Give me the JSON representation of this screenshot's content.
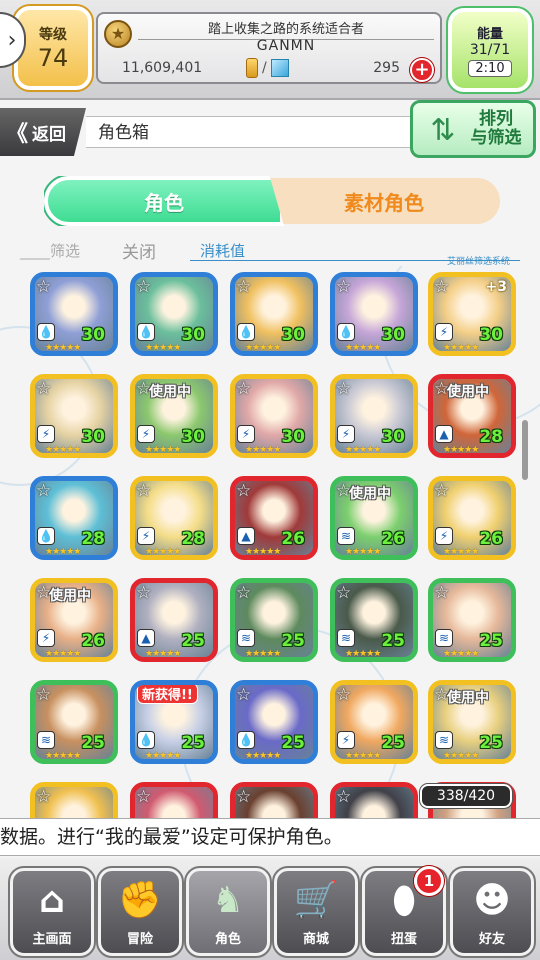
{
  "top_bar": {
    "level_label": "等级",
    "level_value": "74",
    "title": "踏上收集之路的系统适合者",
    "username": "GANMN",
    "gold": "11,609,401",
    "currency_separator": "/",
    "gems": "295",
    "plus_label": "+",
    "energy_label": "能量",
    "energy_value": "31/71",
    "energy_timer": "2:10"
  },
  "sub_header": {
    "back_label": "返回",
    "back_arrows": "《",
    "title": "角色箱",
    "sort_label": "排列\n与筛选"
  },
  "tabs": {
    "character": "角色",
    "material": "素材角色"
  },
  "filter": {
    "filter_label": "筛选",
    "close_label": "关闭",
    "consume_label": "消耗值",
    "system_label": "艾丽丝筛选系统"
  },
  "cards": [
    {
      "level": "30",
      "frame": "#2f7fd8",
      "art": "#8f9fd6",
      "attr": "water",
      "badge": ""
    },
    {
      "level": "30",
      "frame": "#2f7fd8",
      "art": "#6bbf9c",
      "attr": "water",
      "badge": ""
    },
    {
      "level": "30",
      "frame": "#2f7fd8",
      "art": "#f0c060",
      "attr": "water",
      "badge": ""
    },
    {
      "level": "30",
      "frame": "#2f7fd8",
      "art": "#c6a6d8",
      "attr": "water",
      "badge": ""
    },
    {
      "level": "30",
      "frame": "#f2c020",
      "art": "#f4cf88",
      "attr": "thunder",
      "badge": "+3"
    },
    {
      "level": "30",
      "frame": "#f2c020",
      "art": "#e6d3a4",
      "attr": "thunder",
      "badge": ""
    },
    {
      "level": "30",
      "frame": "#f2c020",
      "art": "#8cc86e",
      "attr": "thunder",
      "badge": "使用中"
    },
    {
      "level": "30",
      "frame": "#f2c020",
      "art": "#e0a8a8",
      "attr": "thunder",
      "badge": ""
    },
    {
      "level": "30",
      "frame": "#f2c020",
      "art": "#c9c9d4",
      "attr": "thunder",
      "badge": ""
    },
    {
      "level": "28",
      "frame": "#e2262d",
      "art": "#d0663a",
      "attr": "fire",
      "badge": "使用中"
    },
    {
      "level": "28",
      "frame": "#2f7fd8",
      "art": "#5ebfd6",
      "attr": "water",
      "badge": ""
    },
    {
      "level": "28",
      "frame": "#f2c020",
      "art": "#f4dd88",
      "attr": "thunder",
      "badge": ""
    },
    {
      "level": "26",
      "frame": "#e2262d",
      "art": "#a03a3a",
      "attr": "fire",
      "badge": ""
    },
    {
      "level": "26",
      "frame": "#3fbf5a",
      "art": "#7ccf6e",
      "attr": "wind",
      "badge": "使用中"
    },
    {
      "level": "26",
      "frame": "#f2c020",
      "art": "#f0d070",
      "attr": "thunder",
      "badge": ""
    },
    {
      "level": "26",
      "frame": "#f2c020",
      "art": "#e8b088",
      "attr": "thunder",
      "badge": "使用中"
    },
    {
      "level": "25",
      "frame": "#e2262d",
      "art": "#b0b0c0",
      "attr": "fire",
      "badge": ""
    },
    {
      "level": "25",
      "frame": "#3fbf5a",
      "art": "#5e8a5e",
      "attr": "wind",
      "badge": ""
    },
    {
      "level": "25",
      "frame": "#3fbf5a",
      "art": "#4a5a4a",
      "attr": "wind",
      "badge": ""
    },
    {
      "level": "25",
      "frame": "#3fbf5a",
      "art": "#e6b89a",
      "attr": "wind",
      "badge": ""
    },
    {
      "level": "25",
      "frame": "#3fbf5a",
      "art": "#c89060",
      "attr": "wind",
      "badge": ""
    },
    {
      "level": "25",
      "frame": "#2f7fd8",
      "art": "#c8d0e6",
      "attr": "water",
      "badge": "新获得!!"
    },
    {
      "level": "25",
      "frame": "#2f7fd8",
      "art": "#6a6ac8",
      "attr": "water",
      "badge": ""
    },
    {
      "level": "25",
      "frame": "#f2c020",
      "art": "#f0a860",
      "attr": "thunder",
      "badge": ""
    },
    {
      "level": "25",
      "frame": "#f2c020",
      "art": "#e8d080",
      "attr": "wind",
      "badge": "使用中"
    },
    {
      "level": "",
      "frame": "#f2c020",
      "art": "#f0c050",
      "attr": "",
      "badge": ""
    },
    {
      "level": "",
      "frame": "#e2262d",
      "art": "#d05a70",
      "attr": "",
      "badge": ""
    },
    {
      "level": "",
      "frame": "#e2262d",
      "art": "#6a4030",
      "attr": "",
      "badge": ""
    },
    {
      "level": "",
      "frame": "#e2262d",
      "art": "#404048",
      "attr": "",
      "badge": ""
    },
    {
      "level": "",
      "frame": "#e2262d",
      "art": "#d0a080",
      "attr": "",
      "badge": ""
    }
  ],
  "card_stars": "★★★★★",
  "card_count": "338/420",
  "tip": "数据。进行“我的最爱”设定可保护角色。",
  "nav": [
    {
      "label": "主画面",
      "icon": "home-icon",
      "glyph": "⌂"
    },
    {
      "label": "冒险",
      "icon": "handshake-icon",
      "glyph": "✊"
    },
    {
      "label": "角色",
      "icon": "rabbit-icon",
      "glyph": "♞"
    },
    {
      "label": "商城",
      "icon": "cart-icon",
      "glyph": "🛒"
    },
    {
      "label": "扭蛋",
      "icon": "egg-icon",
      "glyph": "⬮"
    },
    {
      "label": "好友",
      "icon": "friends-icon",
      "glyph": "☻"
    }
  ],
  "notification_count": "1"
}
